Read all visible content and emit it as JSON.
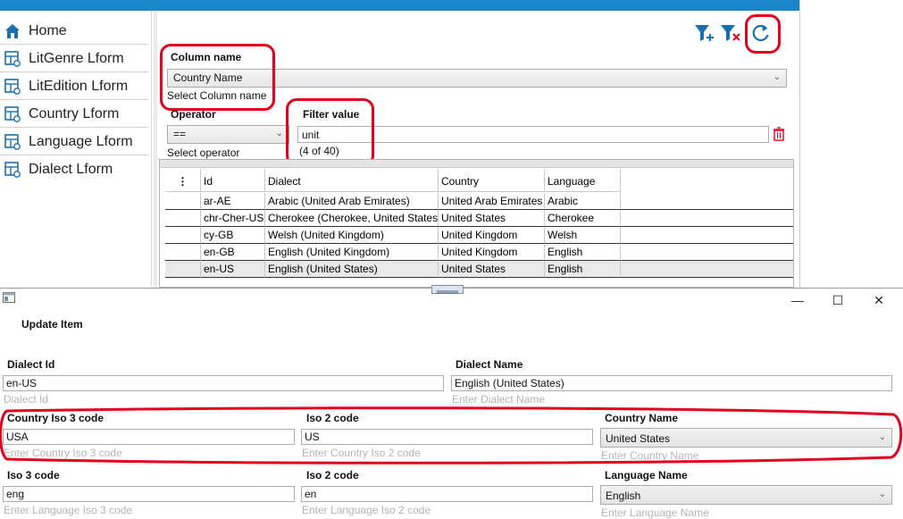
{
  "sidebar": {
    "items": [
      {
        "label": "Home",
        "icon": "home-icon"
      },
      {
        "label": "LitGenre Lform",
        "icon": "form-icon"
      },
      {
        "label": "LitEdition Lform",
        "icon": "form-icon"
      },
      {
        "label": "Country Lform",
        "icon": "form-icon"
      },
      {
        "label": "Language Lform",
        "icon": "form-icon"
      },
      {
        "label": "Dialect Lform",
        "icon": "form-icon"
      }
    ]
  },
  "toolbar": {
    "add_filter_icon": "filter-add-icon",
    "clear_filter_icon": "filter-clear-icon",
    "refresh_icon": "refresh-icon"
  },
  "filter": {
    "column_name_label": "Column name",
    "column_name_value": "Country Name",
    "column_name_hint": "Select Column name",
    "operator_label": "Operator",
    "operator_value": "==",
    "operator_hint": "Select operator",
    "filter_value_label": "Filter value",
    "filter_value": "unit",
    "filter_count": "(4 of 40)"
  },
  "grid": {
    "menu_glyph": "⋮",
    "columns": [
      "Id",
      "Dialect",
      "Country",
      "Language"
    ],
    "rows": [
      [
        "ar-AE",
        "Arabic (United Arab Emirates)",
        "United Arab Emirates",
        "Arabic"
      ],
      [
        "chr-Cher-US",
        "Cherokee (Cherokee, United States)",
        "United States",
        "Cherokee"
      ],
      [
        "cy-GB",
        "Welsh (United Kingdom)",
        "United Kingdom",
        "Welsh"
      ],
      [
        "en-GB",
        "English (United Kingdom)",
        "United Kingdom",
        "English"
      ],
      [
        "en-US",
        "English (United States)",
        "United States",
        "English"
      ]
    ]
  },
  "dialog": {
    "title": "Update Item",
    "minimize": "—",
    "maximize": "☐",
    "close": "✕",
    "dialect_id_label": "Dialect Id",
    "dialect_id_value": "en-US",
    "dialect_id_hint": "Dialect Id",
    "dialect_name_label": "Dialect Name",
    "dialect_name_value": "English (United States)",
    "dialect_name_hint": "Enter Dialect Name",
    "country_iso3_label": "Country Iso 3 code",
    "country_iso3_value": "USA",
    "country_iso3_hint": "Enter Country Iso 3 code",
    "country_iso2_label": "Iso 2 code",
    "country_iso2_value": "US",
    "country_iso2_hint": "Enter Country Iso 2 code",
    "country_name_label": "Country Name",
    "country_name_value": "United States",
    "country_name_hint": "Enter Country Name",
    "lang_iso3_label": "Iso 3 code",
    "lang_iso3_value": "eng",
    "lang_iso3_hint": "Enter Language Iso 3 code",
    "lang_iso2_label": "Iso 2 code",
    "lang_iso2_value": "en",
    "lang_iso2_hint": "Enter Language Iso 2 code",
    "language_name_label": "Language Name",
    "language_name_value": "English",
    "language_name_hint": "Enter Language Name"
  },
  "colors": {
    "accent": "#1a86c8",
    "highlight": "#e3001b"
  }
}
